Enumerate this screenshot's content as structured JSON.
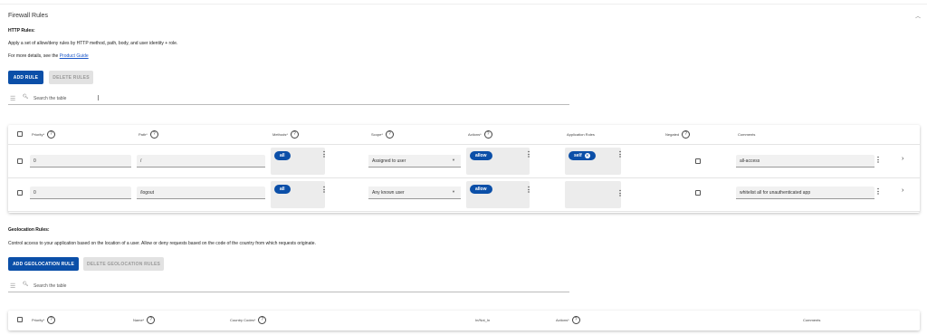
{
  "section": {
    "title": "Firewall Rules",
    "collapse_icon": "chevron-up-icon"
  },
  "http": {
    "title": "HTTP Rules:",
    "description": "Apply a set of allow/deny rules by HTTP method, path, body, and user identity + role.",
    "details_prefix": "For more details, see the ",
    "details_link": "Product Guide",
    "add_label": "ADD RULE",
    "delete_label": "DELETE RULES",
    "search_placeholder": "Search the table",
    "columns": {
      "priority": "Priority*",
      "path": "Path*",
      "methods": "Methods*",
      "scope": "Scope*",
      "actions": "Actions*",
      "app_roles": "Application Roles",
      "negated": "Negated",
      "comments": "Comments"
    },
    "rows": [
      {
        "priority": "0",
        "path": "/",
        "method": "all",
        "scope": "Assigned to user",
        "action": "allow",
        "role": "self",
        "comment": "all-access"
      },
      {
        "priority": "0",
        "path": "/logout",
        "method": "all",
        "scope": "Any known user",
        "action": "allow",
        "role": "",
        "comment": "whitelist all for unauthenticated app"
      }
    ]
  },
  "geo": {
    "title": "Geolocation Rules:",
    "description": "Control access to your application based on the location of a user. Allow or deny requests based on the code of the country from which requests originate.",
    "add_label": "ADD GEOLOCATION RULE",
    "delete_label": "DELETE GEOLOCATION RULES",
    "search_placeholder": "Search the table",
    "columns": {
      "priority": "Priority*",
      "name": "Name*",
      "country_codes": "Country Codes*",
      "is_not_in": "In/Not_In",
      "actions": "Actions*",
      "comments": "Comments"
    }
  },
  "help_glyph": "?",
  "colors": {
    "primary": "#0b4fa8",
    "disabled": "#e2e2e2"
  }
}
